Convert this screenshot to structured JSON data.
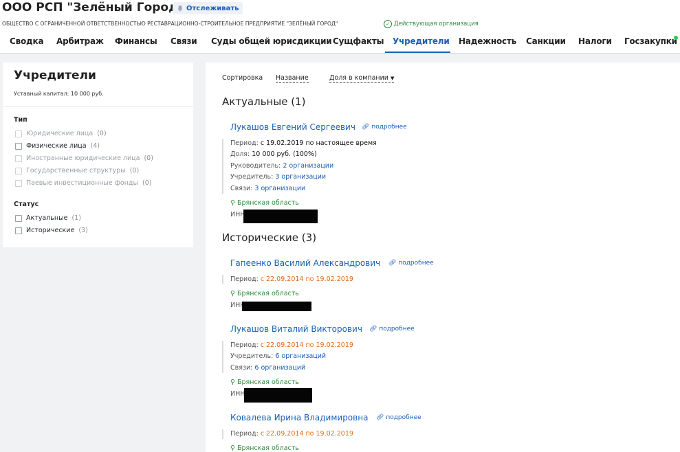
{
  "header": {
    "company_title": "ООО РСП \"Зелёный Город\"",
    "follow_label": "Отслеживать",
    "full_name": "ОБЩЕСТВО С ОГРАНИЧЕННОЙ ОТВЕТСТВЕННОСТЬЮ РЕСТАВРАЦИОННО-СТРОИТЕЛЬНОЕ ПРЕДПРИЯТИЕ \"ЗЕЛЁНЫЙ ГОРОД\"",
    "status": "Действующая организация"
  },
  "tabs": [
    "Сводка",
    "Арбитраж",
    "Финансы",
    "Связи",
    "Суды общей юрисдикции",
    "Сущфакты",
    "Учредители",
    "Надежность",
    "Санкции",
    "Налоги",
    "Госзакупки"
  ],
  "active_tab": "Учредители",
  "sidebar": {
    "title": "Учредители",
    "capital": "Уставный капитал: 10 000 руб.",
    "type_title": "Тип",
    "type_filters": [
      {
        "label": "Юридические лица",
        "count": "(0)",
        "enabled": false
      },
      {
        "label": "Физические лица",
        "count": "(4)",
        "enabled": true
      },
      {
        "label": "Иностранные юридические лица",
        "count": "(0)",
        "enabled": false
      },
      {
        "label": "Государственные структуры",
        "count": "(0)",
        "enabled": false
      },
      {
        "label": "Паевые инвестиционные фонды",
        "count": "(0)",
        "enabled": false
      }
    ],
    "status_title": "Статус",
    "status_filters": [
      {
        "label": "Актуальные",
        "count": "(1)",
        "enabled": true
      },
      {
        "label": "Исторические",
        "count": "(3)",
        "enabled": true
      }
    ]
  },
  "main": {
    "sort_label": "Сортировка",
    "sort_name": "Название",
    "sort_share": "Доля в компании",
    "actual_title": "Актуальные (1)",
    "historical_title": "Исторические (3)",
    "more_label": "подробнее",
    "inn_label": "ИНН",
    "region": "Брянская область",
    "p1": {
      "name": "Лукашов Евгений Сергеевич",
      "period_label": "Период:",
      "period": "с 19.02.2019 по настоящее время",
      "share_label": "Доля:",
      "share": "10 000 руб. (100%)",
      "head_label": "Руководитель:",
      "head": "2 организации",
      "founder_label": "Учредитель:",
      "founder": "3 организации",
      "links_label": "Связи:",
      "links": "3 организации"
    },
    "p2": {
      "name": "Гапеенко Василий Александрович",
      "period_label": "Период:",
      "period": "с 22.09.2014 по 19.02.2019"
    },
    "p3": {
      "name": "Лукашов Виталий Викторович",
      "period_label": "Период:",
      "period": "с 22.09.2014 по 19.02.2019",
      "founder_label": "Учредитель:",
      "founder": "6 организаций",
      "links_label": "Связи:",
      "links": "6 организаций"
    },
    "p4": {
      "name": "Ковалева Ирина Владимировна",
      "period_label": "Период:",
      "period": "с 22.09.2014 по 19.02.2019"
    }
  }
}
